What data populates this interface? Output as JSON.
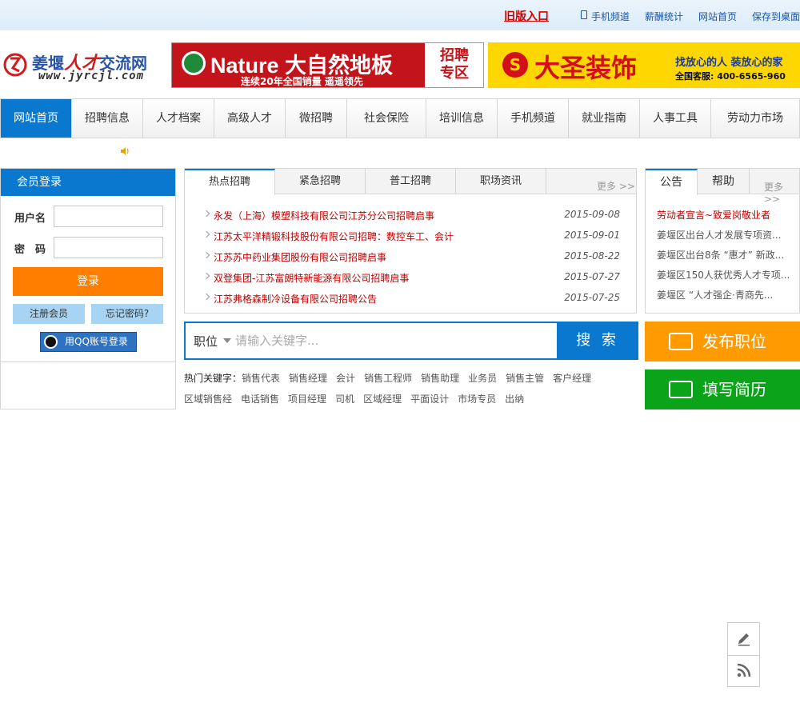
{
  "topbar": {
    "old_version": "旧版入口",
    "links": [
      "手机频道",
      "薪酬统计",
      "网站首页",
      "保存到桌面"
    ]
  },
  "logo": {
    "name_blue1": "姜堰",
    "name_red": "人才",
    "name_blue2": "交流网",
    "url": "www.jyrcjl.com"
  },
  "ads": {
    "nature": {
      "title": "Nature 大自然地板",
      "slogan": "连续20年全国销量 遥遥领先",
      "badge_line1": "招聘",
      "badge_line2": "专区"
    },
    "dasheng": {
      "mark": "S",
      "brand": "大圣装饰",
      "slogan": "找放心的人 装放心的家",
      "hotline": "全国客服: 400-6565-960"
    }
  },
  "nav": {
    "items": [
      "网站首页",
      "招聘信息",
      "人才档案",
      "高级人才",
      "微招聘",
      "社会保险",
      "培训信息",
      "手机频道",
      "就业指南",
      "人事工具",
      "劳动力市场"
    ],
    "active_index": 0
  },
  "login": {
    "title": "会员登录",
    "username_label": "用户名",
    "password_label": "密　码",
    "submit": "登录",
    "register": "注册会员",
    "forgot": "忘记密码?",
    "qq": "用QQ账号登录"
  },
  "news": {
    "tabs": [
      "热点招聘",
      "紧急招聘",
      "普工招聘",
      "职场资讯"
    ],
    "more": "更多 >>",
    "items": [
      {
        "title": "永发（上海）模塑科技有限公司江苏分公司招聘启事",
        "date": "2015-09-08"
      },
      {
        "title": "江苏太平洋精锻科技股份有限公司招聘：数控车工、会计",
        "date": "2015-09-01"
      },
      {
        "title": "江苏苏中药业集团股份有限公司招聘启事",
        "date": "2015-08-22"
      },
      {
        "title": "双登集团-江苏富朗特新能源有限公司招聘启事",
        "date": "2015-07-27"
      },
      {
        "title": "江苏弗格森制冷设备有限公司招聘公告",
        "date": "2015-07-25"
      }
    ]
  },
  "notice": {
    "tabs": [
      "公告",
      "帮助"
    ],
    "more": "更多>>",
    "items": [
      "劳动者宣言~致爱岗敬业者",
      "姜堰区出台人才发展专项资...",
      "姜堰区出台8条 “惠才” 新政...",
      "姜堰区150人获优秀人才专项...",
      "姜堰区 “人才强企·青商先..."
    ]
  },
  "search": {
    "category": "职位",
    "placeholder": "请输入关键字...",
    "button": "搜 索"
  },
  "hotkeys": {
    "label": "热门关键字：",
    "words": [
      "销售代表",
      "销售经理",
      "会计",
      "销售工程师",
      "销售助理",
      "业务员",
      "销售主管",
      "客户经理",
      "区域销售经",
      "电话销售",
      "项目经理",
      "司机",
      "区域经理",
      "平面设计",
      "市场专员",
      "出纳"
    ]
  },
  "actions": {
    "publish": "发布职位",
    "resume": "填写简历"
  },
  "colors": {
    "brand_blue": "#0b78d0",
    "orange": "#ff7e00",
    "publish_orange": "#ff9a00",
    "resume_green": "#0aa319",
    "news_red": "#c00000"
  },
  "icons": [
    "phone-icon",
    "speaker-icon",
    "qq-icon",
    "publish-icon",
    "resume-icon",
    "edit-icon",
    "rss-icon"
  ]
}
